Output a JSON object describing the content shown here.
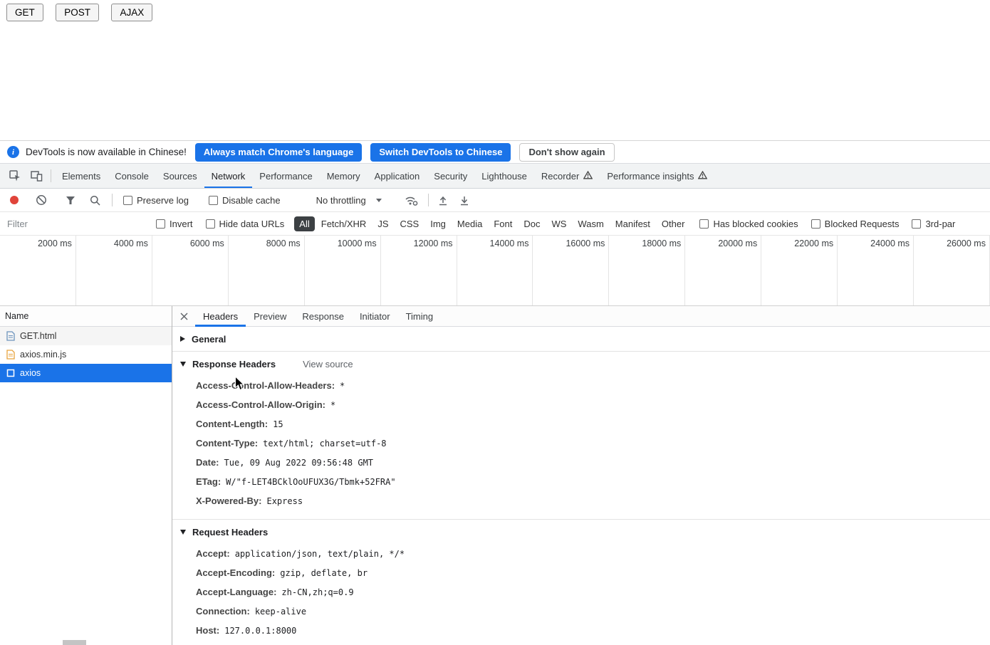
{
  "page": {
    "get_button": "GET",
    "post_button": "POST",
    "ajax_button": "AJAX"
  },
  "infobar": {
    "icon_glyph": "i",
    "message": "DevTools is now available in Chinese!",
    "match_language_button": "Always match Chrome's language",
    "switch_chinese_button": "Switch DevTools to Chinese",
    "dismiss_button": "Don't show again"
  },
  "main_tabs": {
    "items": [
      "Elements",
      "Console",
      "Sources",
      "Network",
      "Performance",
      "Memory",
      "Application",
      "Security",
      "Lighthouse",
      "Recorder",
      "Performance insights"
    ],
    "selected": "Network"
  },
  "network_toolbar": {
    "preserve_log": "Preserve log",
    "disable_cache": "Disable cache",
    "throttling_value": "No throttling"
  },
  "filter_bar": {
    "placeholder": "Filter",
    "invert": "Invert",
    "hide_data_urls": "Hide data URLs",
    "types": [
      "All",
      "Fetch/XHR",
      "JS",
      "CSS",
      "Img",
      "Media",
      "Font",
      "Doc",
      "WS",
      "Wasm",
      "Manifest",
      "Other"
    ],
    "selected_type": "All",
    "has_blocked_cookies": "Has blocked cookies",
    "blocked_requests": "Blocked Requests",
    "third_party": "3rd-par"
  },
  "timeline": {
    "labels": [
      "2000 ms",
      "4000 ms",
      "6000 ms",
      "8000 ms",
      "10000 ms",
      "12000 ms",
      "14000 ms",
      "16000 ms",
      "18000 ms",
      "20000 ms",
      "22000 ms",
      "24000 ms",
      "26000 ms"
    ]
  },
  "requests": {
    "header": "Name",
    "rows": [
      {
        "name": "GET.html",
        "icon": "document-icon"
      },
      {
        "name": "axios.min.js",
        "icon": "script-icon"
      },
      {
        "name": "axios",
        "icon": "xhr-icon"
      }
    ],
    "selected": "axios"
  },
  "details": {
    "tabs": [
      "Headers",
      "Preview",
      "Response",
      "Initiator",
      "Timing"
    ],
    "selected_tab": "Headers",
    "general_title": "General",
    "response_headers_title": "Response Headers",
    "view_source": "View source",
    "request_headers_title": "Request Headers",
    "response_headers": [
      {
        "key": "Access-Control-Allow-Headers:",
        "value": "*"
      },
      {
        "key": "Access-Control-Allow-Origin:",
        "value": "*"
      },
      {
        "key": "Content-Length:",
        "value": "15"
      },
      {
        "key": "Content-Type:",
        "value": "text/html; charset=utf-8"
      },
      {
        "key": "Date:",
        "value": "Tue, 09 Aug 2022 09:56:48 GMT"
      },
      {
        "key": "ETag:",
        "value": "W/\"f-LET4BCklOoUFUX3G/Tbmk+52FRA\""
      },
      {
        "key": "X-Powered-By:",
        "value": "Express"
      }
    ],
    "request_headers": [
      {
        "key": "Accept:",
        "value": "application/json, text/plain, */*"
      },
      {
        "key": "Accept-Encoding:",
        "value": "gzip, deflate, br"
      },
      {
        "key": "Accept-Language:",
        "value": "zh-CN,zh;q=0.9"
      },
      {
        "key": "Connection:",
        "value": "keep-alive"
      },
      {
        "key": "Host:",
        "value": "127.0.0.1:8000"
      }
    ]
  },
  "colors": {
    "accent": "#1a73e8",
    "record_red": "#e0443a",
    "selected_filter_bg": "#3c4043",
    "selection_blue": "#1a73e8"
  }
}
